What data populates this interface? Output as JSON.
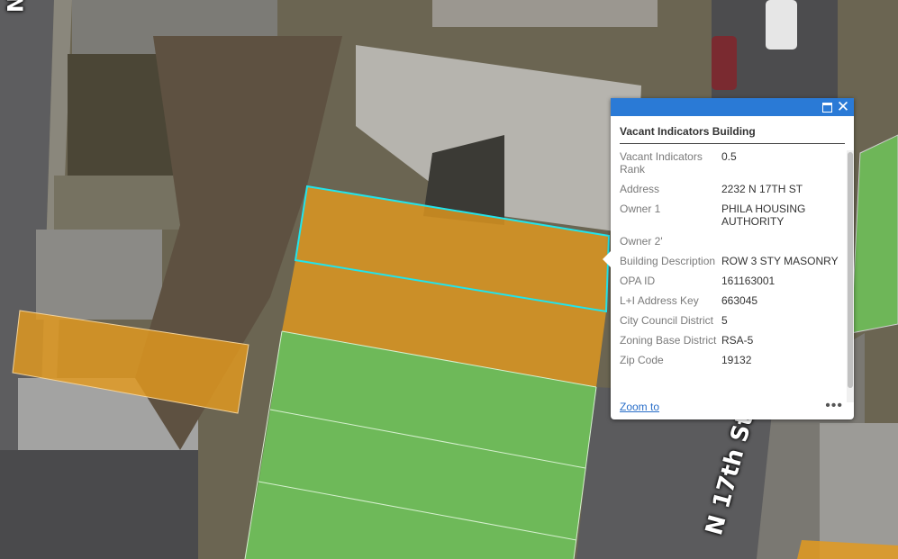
{
  "map": {
    "street_labels": {
      "n17th": "N 17th St",
      "n": "N"
    },
    "colors": {
      "vacant_fill": "#e39a1e",
      "occupied_fill": "#6fd15b",
      "selection_outline": "#22e4ec"
    }
  },
  "popup": {
    "title": "Vacant Indicators Building",
    "maximize_icon": "maximize-icon",
    "close_icon": "close-icon",
    "fields": [
      {
        "name": "Vacant Indicators Rank",
        "value": "0.5"
      },
      {
        "name": "Address",
        "value": "2232 N 17TH ST"
      },
      {
        "name": "Owner 1",
        "value": "PHILA HOUSING AUTHORITY"
      },
      {
        "name": "Owner 2'",
        "value": ""
      },
      {
        "name": "Building Description",
        "value": "ROW 3 STY MASONRY"
      },
      {
        "name": "OPA ID",
        "value": "161163001"
      },
      {
        "name": "L+I Address Key",
        "value": "663045"
      },
      {
        "name": "City Council District",
        "value": "5"
      },
      {
        "name": "Zoning Base District",
        "value": "RSA-5"
      },
      {
        "name": "Zip Code",
        "value": "19132"
      }
    ],
    "zoom_to_label": "Zoom to",
    "more_label": "•••"
  }
}
